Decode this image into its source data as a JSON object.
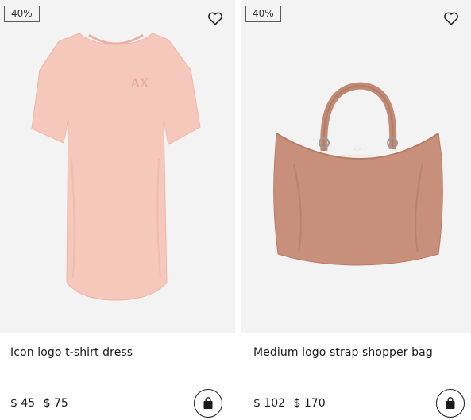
{
  "products": [
    {
      "discount_badge": "40%",
      "name": "Icon logo t-shirt dress",
      "price_current": "$ 45",
      "price_original": "$ 75",
      "wishlist_icon": "heart-outline-icon",
      "cart_icon": "shopping-bag-icon",
      "product_color": "#f7c9bd"
    },
    {
      "discount_badge": "40%",
      "name": "Medium logo strap shopper bag",
      "price_current": "$ 102",
      "price_original": "$ 170",
      "wishlist_icon": "heart-outline-icon",
      "cart_icon": "shopping-bag-icon",
      "product_color": "#c8907a"
    }
  ]
}
